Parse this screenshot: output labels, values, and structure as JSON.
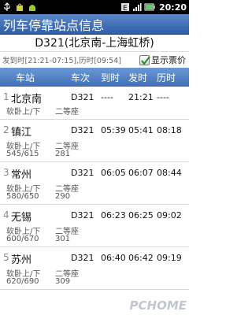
{
  "status_bar": {
    "time": "20:20",
    "icons": [
      "usb-icon",
      "bag-icon",
      "android-icon",
      "e-signal-icon",
      "signal-icon",
      "battery-icon"
    ]
  },
  "app_title": "列车停靠站点信息",
  "train_header": "D321(北京南-上海虹桥)",
  "info": "发到时[21:21-07:15],历时[09:54]",
  "show_price": {
    "label": "显示票价",
    "checked": true
  },
  "columns": [
    "车站",
    "车次",
    "到时",
    "发时",
    "历时"
  ],
  "stations": [
    {
      "index": "1",
      "name": "北京南",
      "train": "D321",
      "arrive": "----",
      "depart": "21:21",
      "duration": "----",
      "seat1": "软卧上/下",
      "seat2": "二等座",
      "price1": "",
      "price2": ""
    },
    {
      "index": "2",
      "name": "镇江",
      "train": "D321",
      "arrive": "05:39",
      "depart": "05:41",
      "duration": "08:18",
      "seat1": "软卧上/下",
      "seat2": "二等座",
      "price1": "545/615",
      "price2": "281"
    },
    {
      "index": "3",
      "name": "常州",
      "train": "D321",
      "arrive": "06:05",
      "depart": "06:07",
      "duration": "08:44",
      "seat1": "软卧上/下",
      "seat2": "二等座",
      "price1": "580/650",
      "price2": "290"
    },
    {
      "index": "4",
      "name": "无锡",
      "train": "D321",
      "arrive": "06:23",
      "depart": "06:25",
      "duration": "09:02",
      "seat1": "软卧上/下",
      "seat2": "二等座",
      "price1": "600/670",
      "price2": "301"
    },
    {
      "index": "5",
      "name": "苏州",
      "train": "D321",
      "arrive": "06:40",
      "depart": "06:42",
      "duration": "09:19",
      "seat1": "软卧上/下",
      "seat2": "二等座",
      "price1": "620/690",
      "price2": "309"
    }
  ],
  "watermark": "PCHOME"
}
